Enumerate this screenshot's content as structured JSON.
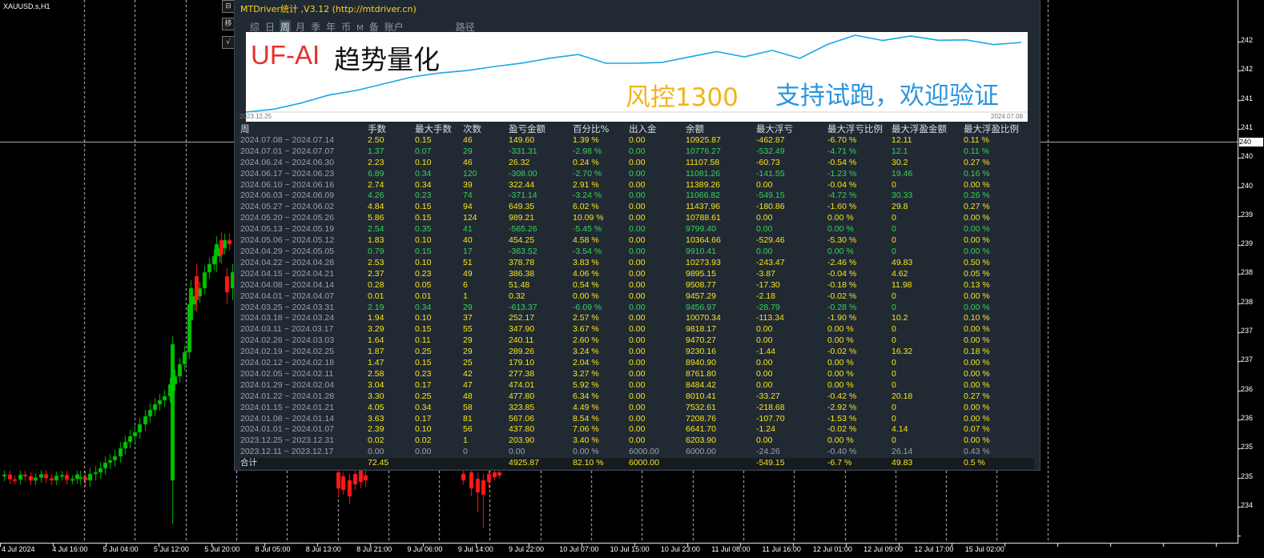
{
  "chart": {
    "symbol": "XAUUSD.s,H1",
    "x_ticks": [
      "4 Jul 2024",
      "4 Jul 16:00",
      "5 Jul 04:00",
      "5 Jul 12:00",
      "5 Jul 20:00",
      "8 Jul 05:00",
      "8 Jul 13:00",
      "8 Jul 21:00",
      "9 Jul 06:00",
      "9 Jul 14:00",
      "9 Jul 22:00",
      "10 Jul 07:00",
      "10 Jul 15:00",
      "10 Jul 23:00",
      "11 Jul 08:00",
      "11 Jul 16:00",
      "12 Jul 01:00",
      "12 Jul 09:00",
      "12 Jul 17:00",
      "15 Jul 02:00"
    ],
    "y_ticks": [
      "242",
      "242",
      "241",
      "241",
      "240",
      "240",
      "239",
      "239",
      "238",
      "238",
      "237",
      "237",
      "236",
      "236",
      "235",
      "235",
      "234"
    ],
    "current_price": "240",
    "side_buttons": [
      "⊟",
      "移",
      "√"
    ],
    "colors": {
      "bull": "#00c400",
      "bear": "#ff1a1a",
      "grid": "#cfcfcf"
    }
  },
  "panel": {
    "title": "MTDriver统计 ,V3.12 (http://mtdriver.cn)",
    "tabs": [
      {
        "label": "综",
        "active": false
      },
      {
        "label": "日",
        "active": false
      },
      {
        "label": "周",
        "active": true
      },
      {
        "label": "月",
        "active": false
      },
      {
        "label": "季",
        "active": false
      },
      {
        "label": "年",
        "active": false
      },
      {
        "label": "币",
        "active": false
      },
      {
        "label": "M",
        "active": false
      },
      {
        "label": "备",
        "active": false
      },
      {
        "label": "账户",
        "active": false
      },
      {
        "label": "路径",
        "active": false
      }
    ],
    "equity": {
      "watermark_brand": "UF-AI",
      "watermark_title": "趋势量化",
      "watermark_risk": "风控1300",
      "watermark_slogan": "支持试跑，欢迎验证",
      "start_date": "2023.12.25",
      "end_date": "2024.07.08",
      "line_color": "#1aa7e8"
    },
    "table": {
      "headers": [
        "周",
        "手数",
        "最大手数",
        "次数",
        "盈亏金额",
        "百分比%",
        "出入金",
        "余额",
        "最大浮亏",
        "最大浮亏比例",
        "最大浮盈金额",
        "最大浮盈比例"
      ],
      "rows": [
        {
          "c": "y",
          "cells": [
            "2024.07.08 ~ 2024.07.14",
            "2.50",
            "0.15",
            "46",
            "149.60",
            "1.39 %",
            "0.00",
            "10925.87",
            "-462.87",
            "-6.70 %",
            "12.11",
            "0.11 %"
          ]
        },
        {
          "c": "g",
          "cells": [
            "2024.07.01 ~ 2024.07.07",
            "1.37",
            "0.07",
            "29",
            "-331.31",
            "-2.98 %",
            "0.00",
            "10776.27",
            "-532.49",
            "-4.71 %",
            "12.1",
            "0.11 %"
          ]
        },
        {
          "c": "y",
          "cells": [
            "2024.06.24 ~ 2024.06.30",
            "2.23",
            "0.10",
            "46",
            "26.32",
            "0.24 %",
            "0.00",
            "11107.58",
            "-60.73",
            "-0.54 %",
            "30.2",
            "0.27 %"
          ]
        },
        {
          "c": "g",
          "cells": [
            "2024.06.17 ~ 2024.06.23",
            "6.89",
            "0.34",
            "120",
            "-308.00",
            "-2.70 %",
            "0.00",
            "11081.26",
            "-141.55",
            "-1.23 %",
            "19.46",
            "0.16 %"
          ]
        },
        {
          "c": "y",
          "cells": [
            "2024.06.10 ~ 2024.06.16",
            "2.74",
            "0.34",
            "39",
            "322.44",
            "2.91 %",
            "0.00",
            "11389.26",
            "0.00",
            "-0.04 %",
            "0",
            "0.00 %"
          ]
        },
        {
          "c": "g",
          "cells": [
            "2024.06.03 ~ 2024.06.09",
            "4.26",
            "0.23",
            "74",
            "-371.14",
            "-3.24 %",
            "0.00",
            "11066.82",
            "-549.15",
            "-4.72 %",
            "30.33",
            "0.26 %"
          ]
        },
        {
          "c": "y",
          "cells": [
            "2024.05.27 ~ 2024.06.02",
            "4.84",
            "0.15",
            "94",
            "649.35",
            "6.02 %",
            "0.00",
            "11437.96",
            "-180.86",
            "-1.60 %",
            "29.8",
            "0.27 %"
          ]
        },
        {
          "c": "y",
          "cells": [
            "2024.05.20 ~ 2024.05.26",
            "5.86",
            "0.15",
            "124",
            "989.21",
            "10.09 %",
            "0.00",
            "10788.61",
            "0.00",
            "0.00 %",
            "0",
            "0.00 %"
          ]
        },
        {
          "c": "g",
          "cells": [
            "2024.05.13 ~ 2024.05.19",
            "2.54",
            "0.35",
            "41",
            "-565.26",
            "-5.45 %",
            "0.00",
            "9799.40",
            "0.00",
            "0.00 %",
            "0",
            "0.00 %"
          ]
        },
        {
          "c": "y",
          "cells": [
            "2024.05.06 ~ 2024.05.12",
            "1.83",
            "0.10",
            "40",
            "454.25",
            "4.58 %",
            "0.00",
            "10364.66",
            "-529.46",
            "-5.30 %",
            "0",
            "0.00 %"
          ]
        },
        {
          "c": "g",
          "cells": [
            "2024.04.29 ~ 2024.05.05",
            "0.79",
            "0.15",
            "17",
            "-363.52",
            "-3.54 %",
            "0.00",
            "9910.41",
            "0.00",
            "0.00 %",
            "0",
            "0.00 %"
          ]
        },
        {
          "c": "y",
          "cells": [
            "2024.04.22 ~ 2024.04.28",
            "2.53",
            "0.10",
            "51",
            "378.78",
            "3.83 %",
            "0.00",
            "10273.93",
            "-243.47",
            "-2.46 %",
            "49.83",
            "0.50 %"
          ]
        },
        {
          "c": "y",
          "cells": [
            "2024.04.15 ~ 2024.04.21",
            "2.37",
            "0.23",
            "49",
            "386.38",
            "4.06 %",
            "0.00",
            "9895.15",
            "-3.87",
            "-0.04 %",
            "4.62",
            "0.05 %"
          ]
        },
        {
          "c": "y",
          "cells": [
            "2024.04.08 ~ 2024.04.14",
            "0.28",
            "0.05",
            "6",
            "51.48",
            "0.54 %",
            "0.00",
            "9508.77",
            "-17.30",
            "-0.18 %",
            "11.98",
            "0.13 %"
          ]
        },
        {
          "c": "y",
          "cells": [
            "2024.04.01 ~ 2024.04.07",
            "0.01",
            "0.01",
            "1",
            "0.32",
            "0.00 %",
            "0.00",
            "9457.29",
            "-2.18",
            "-0.02 %",
            "0",
            "0.00 %"
          ]
        },
        {
          "c": "g",
          "cells": [
            "2024.03.25 ~ 2024.03.31",
            "2.19",
            "0.34",
            "29",
            "-613.37",
            "-6.09 %",
            "0.00",
            "9456.97",
            "-28.79",
            "-0.28 %",
            "0",
            "0.00 %"
          ]
        },
        {
          "c": "y",
          "cells": [
            "2024.03.18 ~ 2024.03.24",
            "1.94",
            "0.10",
            "37",
            "252.17",
            "2.57 %",
            "0.00",
            "10070.34",
            "-113.34",
            "-1.90 %",
            "10.2",
            "0.10 %"
          ]
        },
        {
          "c": "y",
          "cells": [
            "2024.03.11 ~ 2024.03.17",
            "3.29",
            "0.15",
            "55",
            "347.90",
            "3.67 %",
            "0.00",
            "9818.17",
            "0.00",
            "0.00 %",
            "0",
            "0.00 %"
          ]
        },
        {
          "c": "y",
          "cells": [
            "2024.02.26 ~ 2024.03.03",
            "1.64",
            "0.11",
            "29",
            "240.11",
            "2.60 %",
            "0.00",
            "9470.27",
            "0.00",
            "0.00 %",
            "0",
            "0.00 %"
          ]
        },
        {
          "c": "y",
          "cells": [
            "2024.02.19 ~ 2024.02.25",
            "1.87",
            "0.25",
            "29",
            "289.26",
            "3.24 %",
            "0.00",
            "9230.16",
            "-1.44",
            "-0.02 %",
            "16.32",
            "0.18 %"
          ]
        },
        {
          "c": "y",
          "cells": [
            "2024.02.12 ~ 2024.02.18",
            "1.47",
            "0.15",
            "25",
            "179.10",
            "2.04 %",
            "0.00",
            "8940.90",
            "0.00",
            "0.00 %",
            "0",
            "0.00 %"
          ]
        },
        {
          "c": "y",
          "cells": [
            "2024.02.05 ~ 2024.02.11",
            "2.58",
            "0.23",
            "42",
            "277.38",
            "3.27 %",
            "0.00",
            "8761.80",
            "0.00",
            "0.00 %",
            "0",
            "0.00 %"
          ]
        },
        {
          "c": "y",
          "cells": [
            "2024.01.29 ~ 2024.02.04",
            "3.04",
            "0.17",
            "47",
            "474.01",
            "5.92 %",
            "0.00",
            "8484.42",
            "0.00",
            "0.00 %",
            "0",
            "0.00 %"
          ]
        },
        {
          "c": "y",
          "cells": [
            "2024.01.22 ~ 2024.01.28",
            "3.30",
            "0.25",
            "48",
            "477.80",
            "6.34 %",
            "0.00",
            "8010.41",
            "-33.27",
            "-0.42 %",
            "20.18",
            "0.27 %"
          ]
        },
        {
          "c": "y",
          "cells": [
            "2024.01.15 ~ 2024.01.21",
            "4.05",
            "0.34",
            "58",
            "323.85",
            "4.49 %",
            "0.00",
            "7532.61",
            "-218.68",
            "-2.92 %",
            "0",
            "0.00 %"
          ]
        },
        {
          "c": "y",
          "cells": [
            "2024.01.08 ~ 2024.01.14",
            "3.63",
            "0.17",
            "81",
            "567.06",
            "8.54 %",
            "0.00",
            "7208.76",
            "-107.70",
            "-1.53 %",
            "0",
            "0.00 %"
          ]
        },
        {
          "c": "y",
          "cells": [
            "2024.01.01 ~ 2024.01.07",
            "2.39",
            "0.10",
            "56",
            "437.80",
            "7.06 %",
            "0.00",
            "6641.70",
            "-1.24",
            "-0.02 %",
            "4.14",
            "0.07 %"
          ]
        },
        {
          "c": "y",
          "cells": [
            "2023.12.25 ~ 2023.12.31",
            "0.02",
            "0.02",
            "1",
            "203.90",
            "3.40 %",
            "0.00",
            "6203.90",
            "0.00",
            "0.00 %",
            "0",
            "0.00 %"
          ]
        },
        {
          "c": "n",
          "cells": [
            "2023.12.11 ~ 2023.12.17",
            "0.00",
            "0.00",
            "0",
            "0.00",
            "0.00 %",
            "6000.00",
            "6000.00",
            "-24.26",
            "-0.40 %",
            "26.14",
            "0.43 %"
          ]
        }
      ],
      "footer": [
        "合计",
        "72.45",
        "",
        "",
        "4925.87",
        "82.10 %",
        "6000.00",
        "",
        "-549.15",
        "-6.7 %",
        "49.83",
        "0.5 %"
      ]
    }
  }
}
